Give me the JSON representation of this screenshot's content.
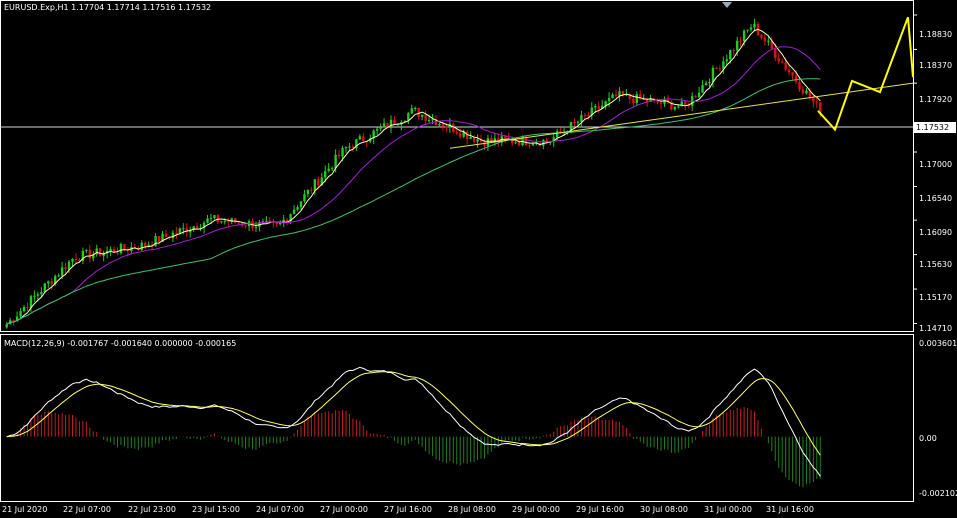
{
  "header": {
    "symbol_line": "EURUSD.Exp,H1  1.17704  1.17714  1.17516  1.17532"
  },
  "icons": {
    "header_icon": "triangle-down-icon",
    "top_marker": "triangle-down-icon"
  },
  "price_axis": {
    "ticks": [
      "1.18830",
      "1.18370",
      "1.17920",
      "1.17000",
      "1.16540",
      "1.16090",
      "1.15630",
      "1.15170",
      "1.14710"
    ],
    "current_price": "1.17532",
    "range": [
      1.1465,
      1.1895
    ]
  },
  "indicator": {
    "label": "MACD(12,26,9) -0.001767 -0.001640 0.000000 -0.000165",
    "ticks": [
      "0.003601",
      "0.00",
      "-0.002102"
    ],
    "range": [
      -0.0023,
      0.0037
    ]
  },
  "time_axis": {
    "labels": [
      "21 Jul 2020",
      "22 Jul 07:00",
      "22 Jul 23:00",
      "23 Jul 15:00",
      "24 Jul 07:00",
      "27 Jul 00:00",
      "27 Jul 16:00",
      "28 Jul 08:00",
      "29 Jul 00:00",
      "29 Jul 16:00",
      "30 Jul 08:00",
      "31 Jul 00:00",
      "31 Jul 16:00"
    ]
  },
  "colors": {
    "background": "#000000",
    "bull_candle": "#22cc22",
    "bear_candle": "#e01010",
    "ma_fast": "#ffffc0",
    "ma_mid": "#a020d0",
    "ma_slow": "#40c070",
    "trendline": "#e8e840",
    "forecast": "#ffff00",
    "macd_line": "#ffffff",
    "signal_line": "#ffff66",
    "hist_pos": "#c02020",
    "hist_neg": "#208020",
    "grid": "#ffffff"
  },
  "chart_data": {
    "type": "line",
    "title": "EURUSD.Exp,H1",
    "xlabel": "",
    "ylabel": "",
    "x": [
      "21 Jul 2020",
      "22 Jul 07:00",
      "22 Jul 23:00",
      "23 Jul 15:00",
      "24 Jul 07:00",
      "27 Jul 00:00",
      "27 Jul 16:00",
      "28 Jul 08:00",
      "29 Jul 00:00",
      "29 Jul 16:00",
      "30 Jul 08:00",
      "31 Jul 00:00",
      "31 Jul 16:00"
    ],
    "series": [
      {
        "values": [
          1.147,
          1.156,
          1.1575,
          1.161,
          1.16,
          1.1705,
          1.1755,
          1.1715,
          1.1715,
          1.1775,
          1.176,
          1.187,
          1.1755
        ]
      }
    ],
    "ylim": [
      1.1465,
      1.1895
    ],
    "current": 1.17532
  }
}
